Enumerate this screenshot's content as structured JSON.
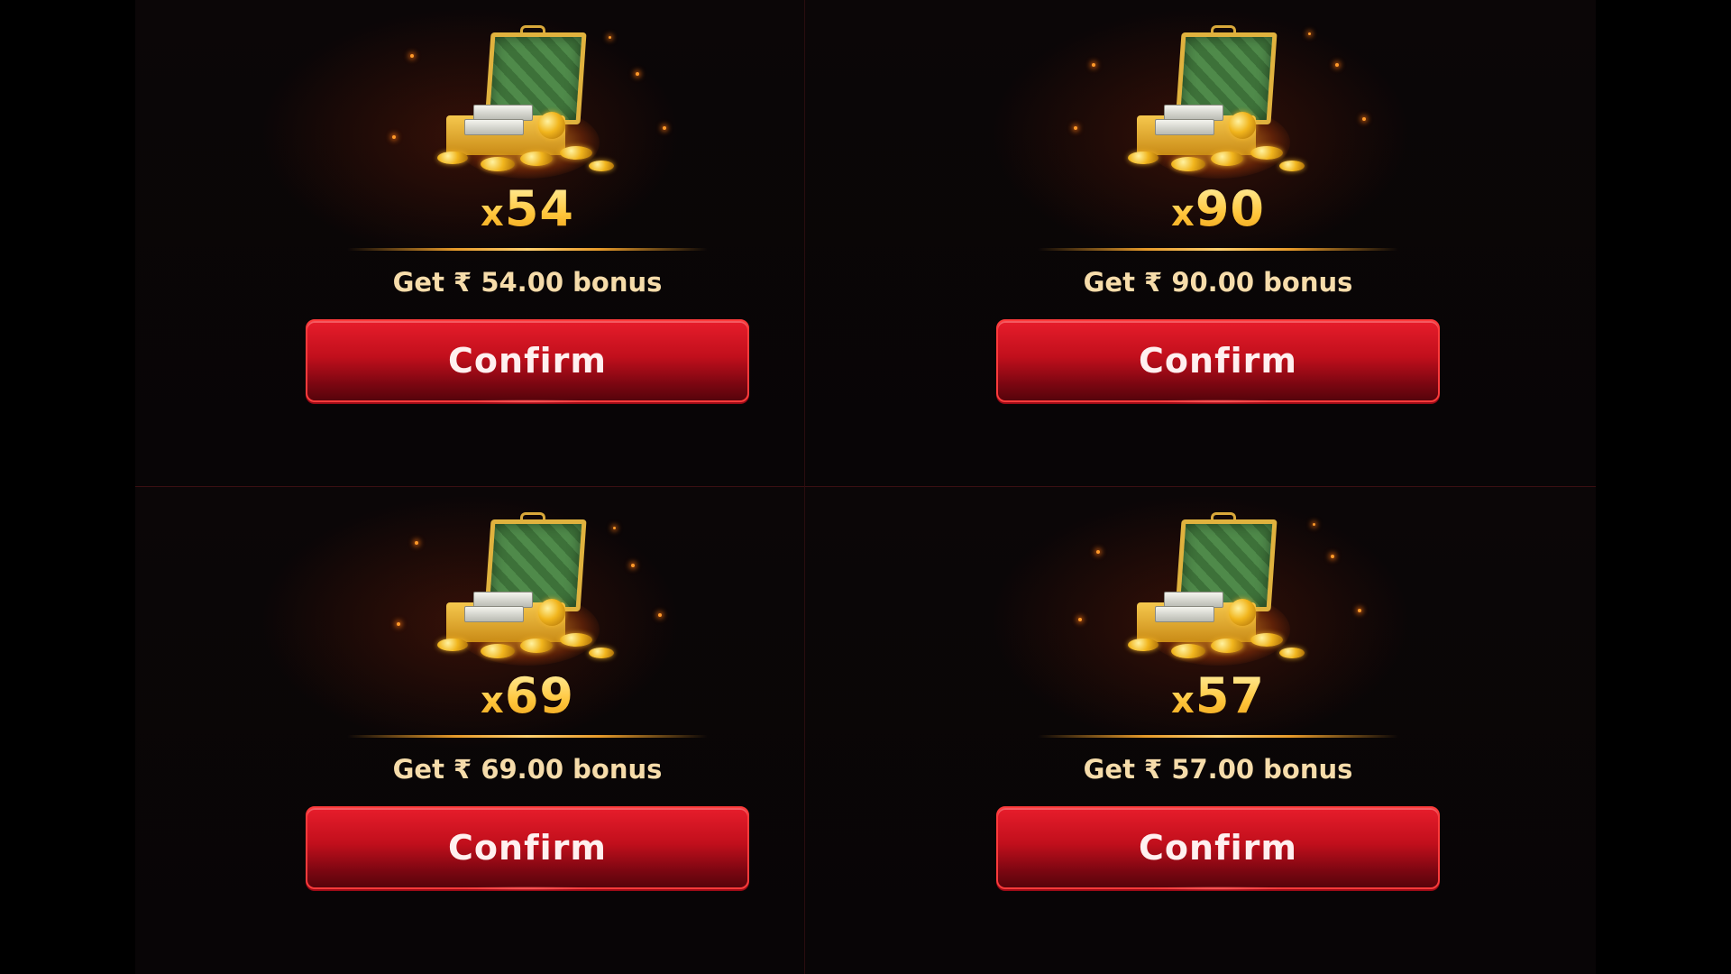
{
  "offers": [
    {
      "multiplier_prefix": "x",
      "multiplier_value": "54",
      "bonus_text": "Get ₹ 54.00 bonus",
      "confirm_label": "Confirm"
    },
    {
      "multiplier_prefix": "x",
      "multiplier_value": "90",
      "bonus_text": "Get ₹ 90.00 bonus",
      "confirm_label": "Confirm"
    },
    {
      "multiplier_prefix": "x",
      "multiplier_value": "69",
      "bonus_text": "Get ₹ 69.00 bonus",
      "confirm_label": "Confirm"
    },
    {
      "multiplier_prefix": "x",
      "multiplier_value": "57",
      "bonus_text": "Get ₹ 57.00 bonus",
      "confirm_label": "Confirm"
    }
  ],
  "colors": {
    "background": "#000000",
    "multiplier_gold": "#ffd15a",
    "bonus_text": "#f6dcaa",
    "button_red": "#c10f1c",
    "chest_lid_green": "#45803f",
    "chest_gold": "#e0b23e"
  },
  "icons": {
    "chest": "treasure-chest-icon"
  }
}
